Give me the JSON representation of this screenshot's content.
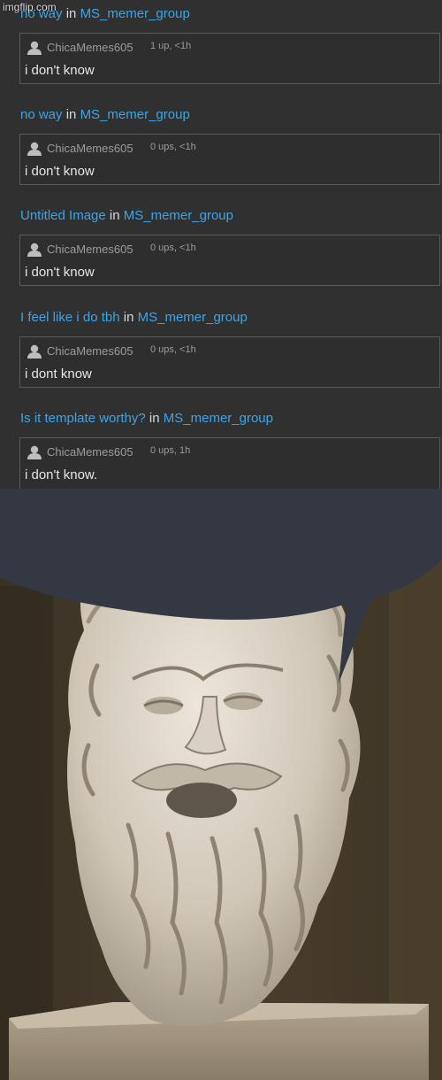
{
  "watermark": "imgflip.com",
  "comments": [
    {
      "post_title": "no way",
      "in_word": "in",
      "group": "MS_memer_group",
      "user": "ChicaMemes605",
      "ups": "1 up, <1h",
      "text": "i don't know"
    },
    {
      "post_title": "no way",
      "in_word": "in",
      "group": "MS_memer_group",
      "user": "ChicaMemes605",
      "ups": "0 ups, <1h",
      "text": "i don't know"
    },
    {
      "post_title": "Untitled Image",
      "in_word": "in",
      "group": "MS_memer_group",
      "user": "ChicaMemes605",
      "ups": "0 ups, <1h",
      "text": "i don't know"
    },
    {
      "post_title": "I feel like i do tbh",
      "in_word": "in",
      "group": "MS_memer_group",
      "user": "ChicaMemes605",
      "ups": "0 ups, <1h",
      "text": "i dont know"
    },
    {
      "post_title": "Is it template worthy?",
      "in_word": "in",
      "group": "MS_memer_group",
      "user": "ChicaMemes605",
      "ups": "0 ups, 1h",
      "text": "i don't know."
    }
  ],
  "colors": {
    "background": "#303030",
    "link": "#3ba5e8",
    "card_border": "#5a5a5a",
    "speech_bubble": "#343843"
  },
  "icons": {
    "avatar": "default-user-avatar-icon"
  },
  "scene": "socrates-bust-with-speech-bubble"
}
